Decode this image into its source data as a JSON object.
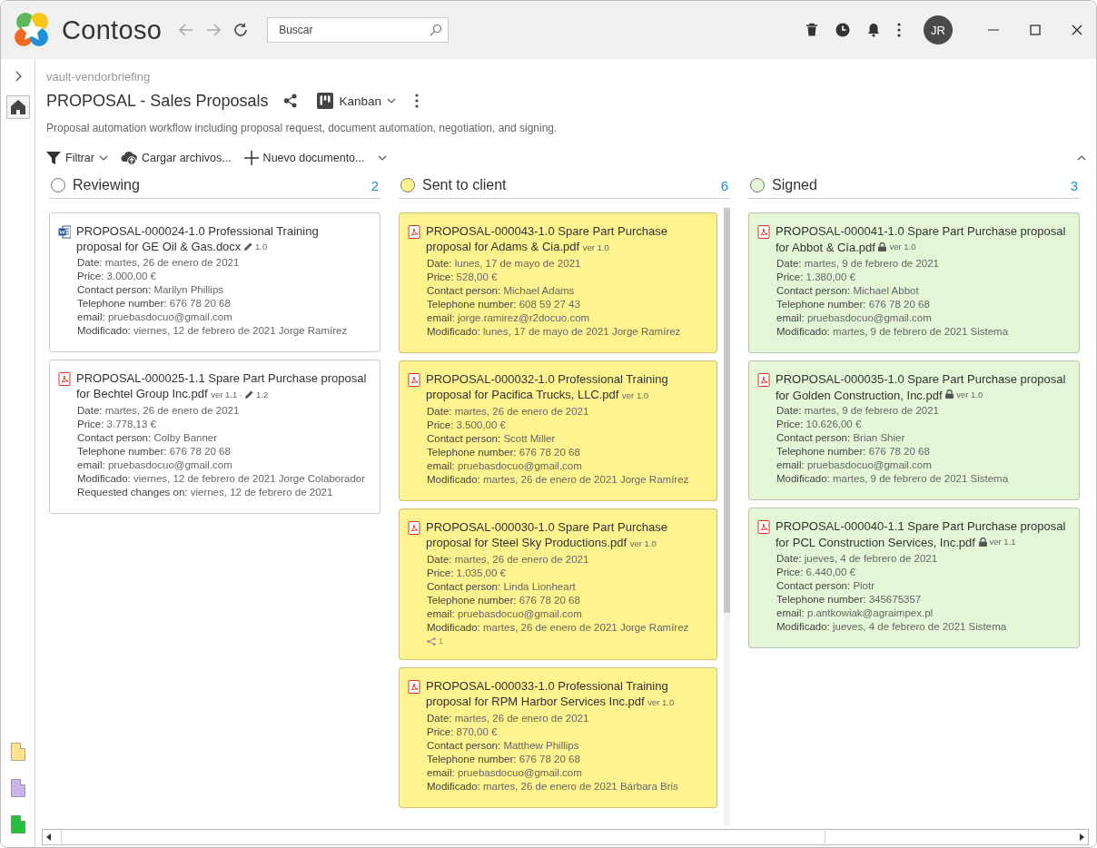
{
  "app": {
    "name": "Contoso",
    "search": {
      "placeholder": "Buscar"
    },
    "user_initials": "JR"
  },
  "page": {
    "breadcrumb": "vault-vendorbriefing",
    "title": "PROPOSAL - Sales Proposals",
    "view": "Kanban",
    "description": "Proposal automation workflow including proposal request, document automation, negotiation, and signing."
  },
  "toolbar": [
    {
      "kind": "filter",
      "label": "Filtrar",
      "dropdown": true
    },
    {
      "kind": "upload",
      "label": "Cargar archivos...",
      "dropdown": false
    },
    {
      "kind": "new",
      "label": "Nuevo documento...",
      "dropdown": true
    }
  ],
  "sidebar": {
    "shortcuts": [
      {
        "color": "#ffe28a"
      },
      {
        "color": "#c9b3ea"
      },
      {
        "color": "#22c33a"
      }
    ]
  },
  "columns": [
    {
      "title": "Reviewing",
      "count": "2",
      "color": "#ffffff",
      "cards": [
        {
          "kind": "docx",
          "title": "PROPOSAL-000024-1.0 Professional Training proposal for GE Oil & Gas.docx",
          "locked": false,
          "edit_version": "1.0",
          "fields": [
            {
              "label": "Date:",
              "value": "martes, 26 de enero de 2021"
            },
            {
              "label": "Price:",
              "value": "3.000,00 €"
            },
            {
              "label": "Contact person:",
              "value": "Marilyn Phillips"
            },
            {
              "label": "Telephone number:",
              "value": "676 78 20 68"
            },
            {
              "label": "email:",
              "value": "pruebasdocuo@gmail.com"
            },
            {
              "label": "Modificado:",
              "value": "viernes, 12 de febrero de 2021 Jorge Ramírez"
            }
          ]
        },
        {
          "kind": "pdf",
          "title": "PROPOSAL-000025-1.1 Spare Part Purchase proposal for Bechtel Group Inc.pdf",
          "locked": false,
          "version": "ver 1.1 ·",
          "edit_version": "1.2",
          "fields": [
            {
              "label": "Date:",
              "value": "martes, 26 de enero de 2021"
            },
            {
              "label": "Price:",
              "value": "3.778,13 €"
            },
            {
              "label": "Contact person:",
              "value": "Colby Banner"
            },
            {
              "label": "Telephone number:",
              "value": "676 78 20 68"
            },
            {
              "label": "email:",
              "value": "pruebasdocuo@gmail.com"
            },
            {
              "label": "Modificado:",
              "value": "viernes, 12 de febrero de 2021 Jorge Colaborador"
            },
            {
              "label": "Requested changes on:",
              "value": "viernes, 12 de febrero de 2021"
            }
          ]
        }
      ]
    },
    {
      "title": "Sent to client",
      "count": "6",
      "color": "#fff38f",
      "cards": [
        {
          "kind": "pdf",
          "title": "PROPOSAL-000043-1.0 Spare Part Purchase proposal for Adams & Cia.pdf",
          "locked": false,
          "version": "ver 1.0",
          "fields": [
            {
              "label": "Date:",
              "value": "lunes, 17 de mayo de 2021"
            },
            {
              "label": "Price:",
              "value": "528,00 €"
            },
            {
              "label": "Contact person:",
              "value": "Michael Adams"
            },
            {
              "label": "Telephone number:",
              "value": "608 59 27 43"
            },
            {
              "label": "email:",
              "value": "jorge.ramirez@r2docuo.com"
            },
            {
              "label": "Modificado:",
              "value": "lunes, 17 de mayo de 2021 Jorge Ramírez"
            }
          ]
        },
        {
          "kind": "pdf",
          "title": "PROPOSAL-000032-1.0 Professional Training proposal for Pacifica Trucks, LLC.pdf",
          "locked": false,
          "version": "ver 1.0",
          "fields": [
            {
              "label": "Date:",
              "value": "martes, 26 de enero de 2021"
            },
            {
              "label": "Price:",
              "value": "3.500,00 €"
            },
            {
              "label": "Contact person:",
              "value": "Scott Miller"
            },
            {
              "label": "Telephone number:",
              "value": "676 78 20 68"
            },
            {
              "label": "email:",
              "value": "pruebasdocuo@gmail.com"
            },
            {
              "label": "Modificado:",
              "value": "martes, 26 de enero de 2021 Jorge Ramírez"
            }
          ]
        },
        {
          "kind": "pdf",
          "title": "PROPOSAL-000030-1.0 Spare Part Purchase proposal for Steel Sky Productions.pdf",
          "locked": false,
          "version": "ver 1.0",
          "shares": "1",
          "fields": [
            {
              "label": "Date:",
              "value": "martes, 26 de enero de 2021"
            },
            {
              "label": "Price:",
              "value": "1.035,00 €"
            },
            {
              "label": "Contact person:",
              "value": "Linda Lionheart"
            },
            {
              "label": "Telephone number:",
              "value": "676 78 20 68"
            },
            {
              "label": "email:",
              "value": "pruebasdocuo@gmail.com"
            },
            {
              "label": "Modificado:",
              "value": "martes, 26 de enero de 2021 Jorge Ramírez"
            }
          ]
        },
        {
          "kind": "pdf",
          "title": "PROPOSAL-000033-1.0 Professional Training proposal for RPM Harbor Services Inc.pdf",
          "locked": false,
          "version": "ver 1.0",
          "fields": [
            {
              "label": "Date:",
              "value": "martes, 26 de enero de 2021"
            },
            {
              "label": "Price:",
              "value": "870,00 €"
            },
            {
              "label": "Contact person:",
              "value": "Matthew Phillips"
            },
            {
              "label": "Telephone number:",
              "value": "676 78 20 68"
            },
            {
              "label": "email:",
              "value": "pruebasdocuo@gmail.com"
            },
            {
              "label": "Modificado:",
              "value": "martes, 26 de enero de 2021 Bárbara Bris"
            }
          ]
        }
      ]
    },
    {
      "title": "Signed",
      "count": "3",
      "color": "#e3f6d5",
      "cards": [
        {
          "kind": "pdf",
          "title": "PROPOSAL-000041-1.0 Spare Part Purchase proposal for Abbot & Cía.pdf",
          "locked": true,
          "version": "ver 1.0",
          "fields": [
            {
              "label": "Date:",
              "value": "martes, 9 de febrero de 2021"
            },
            {
              "label": "Price:",
              "value": "1.380,00 €"
            },
            {
              "label": "Contact person:",
              "value": "Michael Abbot"
            },
            {
              "label": "Telephone number:",
              "value": "676 78 20 68"
            },
            {
              "label": "email:",
              "value": "pruebasdocuo@gmail.com"
            },
            {
              "label": "Modificado:",
              "value": "martes, 9 de febrero de 2021 Sistema"
            }
          ]
        },
        {
          "kind": "pdf",
          "title": "PROPOSAL-000035-1.0 Spare Part Purchase proposal for Golden Construction, Inc.pdf",
          "locked": true,
          "version": "ver 1.0",
          "fields": [
            {
              "label": "Date:",
              "value": "martes, 9 de febrero de 2021"
            },
            {
              "label": "Price:",
              "value": "10.626,00 €"
            },
            {
              "label": "Contact person:",
              "value": "Brian Shier"
            },
            {
              "label": "Telephone number:",
              "value": "676 78 20 68"
            },
            {
              "label": "email:",
              "value": "pruebasdocuo@gmail.com"
            },
            {
              "label": "Modificado:",
              "value": "martes, 9 de febrero de 2021 Sistema"
            }
          ]
        },
        {
          "kind": "pdf",
          "title": "PROPOSAL-000040-1.1 Spare Part Purchase proposal for PCL Construction Services, Inc.pdf",
          "locked": true,
          "version": "ver 1.1",
          "fields": [
            {
              "label": "Date:",
              "value": "jueves, 4 de febrero de 2021"
            },
            {
              "label": "Price:",
              "value": "6.440,00 €"
            },
            {
              "label": "Contact person:",
              "value": "Piotr"
            },
            {
              "label": "Telephone number:",
              "value": "345675357"
            },
            {
              "label": "email:",
              "value": "p.antkowiak@agraimpex.pl"
            },
            {
              "label": "Modificado:",
              "value": "jueves, 4 de febrero de 2021 Sistema"
            }
          ]
        }
      ]
    }
  ]
}
